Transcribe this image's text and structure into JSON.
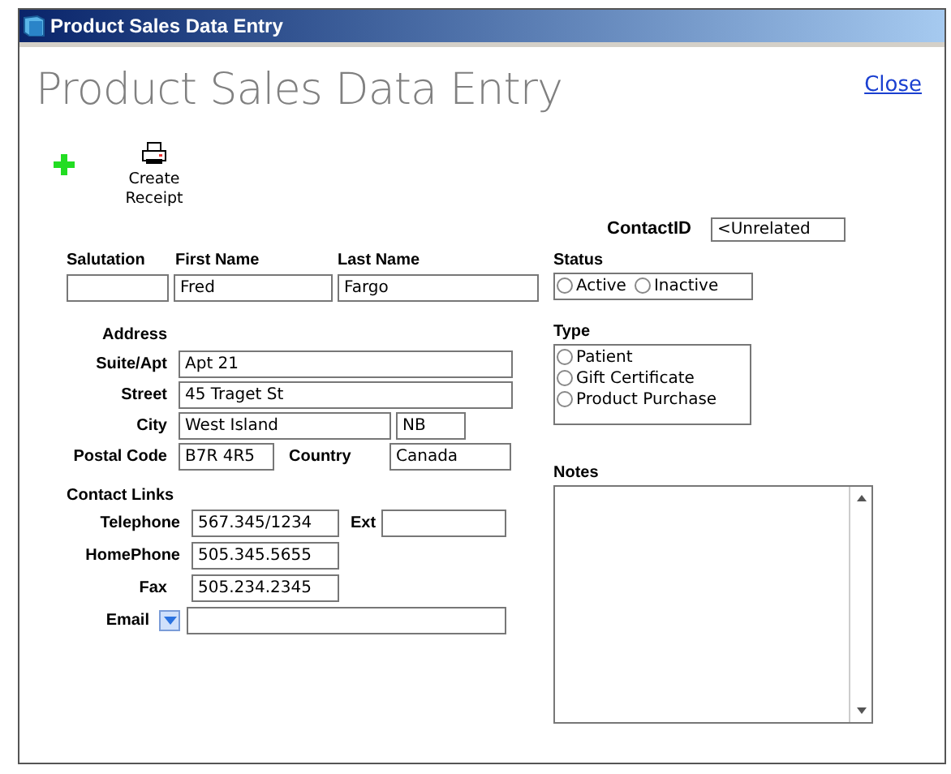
{
  "window": {
    "title": "Product Sales Data Entry"
  },
  "heading": "Product Sales Data Entry",
  "close_link": "Close",
  "toolbar": [
    {
      "kind": "add"
    },
    {
      "kind": "receipt",
      "label": "Create Receipt"
    }
  ],
  "contact_id": {
    "label": "ContactID",
    "value": "<Unrelated"
  },
  "name_fields": [
    {
      "label": "Salutation"
    },
    {
      "label": "First Name",
      "value": "Fred"
    },
    {
      "label": "Last Name",
      "value": "Fargo"
    }
  ],
  "address": {
    "heading": "Address",
    "suite": {
      "label": "Suite/Apt",
      "value": "Apt 21"
    },
    "street": {
      "label": "Street",
      "value": "45 Traget St"
    },
    "city": {
      "label": "City",
      "value": "West Island",
      "region": "NB"
    },
    "postal_code": {
      "label": "Postal Code",
      "value": "B7R 4R5"
    },
    "country": {
      "label": "Country",
      "value": "Canada"
    }
  },
  "contact_links": {
    "heading": "Contact Links",
    "telephone": {
      "label": "Telephone",
      "value": "567.345/1234"
    },
    "ext": {
      "label": "Ext"
    },
    "home_phone": {
      "label": "HomePhone",
      "value": "505.345.5655"
    },
    "fax": {
      "label": "Fax",
      "value": "505.234.2345"
    },
    "email": {
      "label": "Email"
    }
  },
  "status": {
    "label": "Status",
    "options": [
      {
        "label": "Active",
        "selected": false
      },
      {
        "label": "Inactive",
        "selected": false
      }
    ]
  },
  "type": {
    "label": "Type",
    "options": [
      {
        "label": "Patient",
        "selected": false
      },
      {
        "label": "Gift Certificate",
        "selected": false
      },
      {
        "label": "Product Purchase",
        "selected": false
      }
    ]
  },
  "notes": {
    "label": "Notes"
  }
}
